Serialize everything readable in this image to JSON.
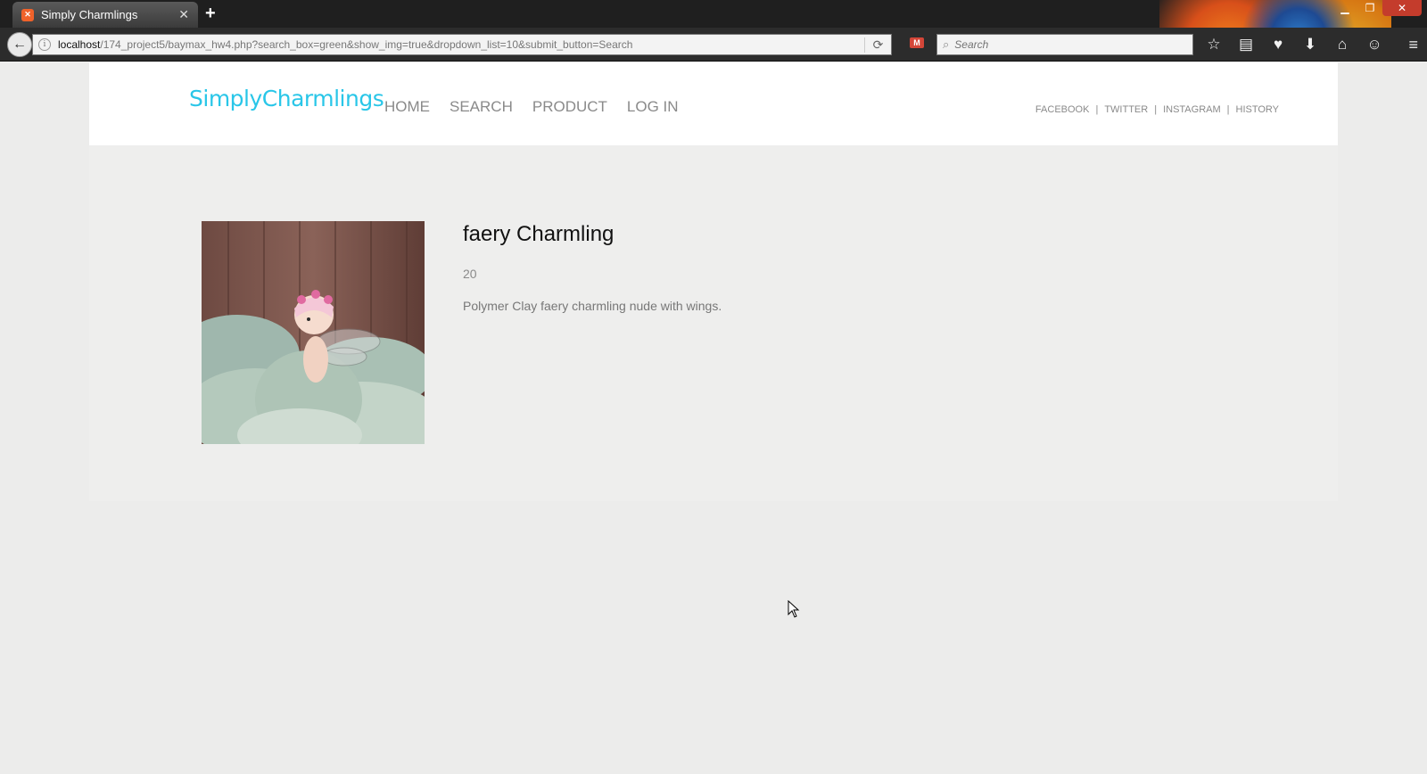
{
  "browser": {
    "tab_title": "Simply Charmlings",
    "url_host": "localhost",
    "url_path": "/174_project5/baymax_hw4.php?search_box=green&show_img=true&dropdown_list=10&submit_button=Search",
    "search_placeholder": "Search"
  },
  "header": {
    "logo": "SimplyCharmlings",
    "nav": [
      "HOME",
      "SEARCH",
      "PRODUCT",
      "LOG IN"
    ],
    "social": [
      "FACEBOOK",
      "TWITTER",
      "INSTAGRAM",
      "HISTORY"
    ],
    "social_separator": "|"
  },
  "product": {
    "name": "faery Charmling",
    "price": "20",
    "description": "Polymer Clay faery charmling nude with wings."
  }
}
